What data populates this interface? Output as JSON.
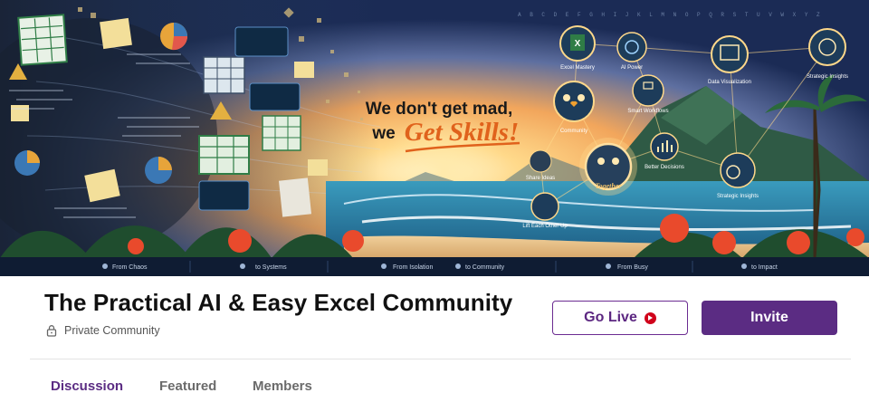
{
  "banner": {
    "headline_line1": "We don't get mad,",
    "headline_we": "we",
    "headline_accent": "Get Skills!",
    "nodes": [
      "Excel Mastery",
      "AI Power",
      "Data Visualization",
      "Strategic Insights",
      "Community",
      "Smart Workflows",
      "Together",
      "Better Decisions",
      "Share Ideas",
      "Strategic Insights",
      "Lift Each Other Up"
    ],
    "strip": [
      "From Chaos",
      "to Systems",
      "From Isolation",
      "to Community",
      "From Busy",
      "to Impact"
    ],
    "letters": "A B C D E F G H I J K L M N O P Q R S T U V W X Y Z"
  },
  "community": {
    "title": "The Practical AI & Easy Excel Community",
    "privacy_label": "Private Community"
  },
  "actions": {
    "go_live_label": "Go Live",
    "invite_label": "Invite"
  },
  "tabs": [
    {
      "label": "Discussion",
      "active": true
    },
    {
      "label": "Featured",
      "active": false
    },
    {
      "label": "Members",
      "active": false
    }
  ],
  "colors": {
    "brand_purple": "#5b2c83",
    "live_red": "#d0021b",
    "headline_orange": "#e0621c"
  }
}
